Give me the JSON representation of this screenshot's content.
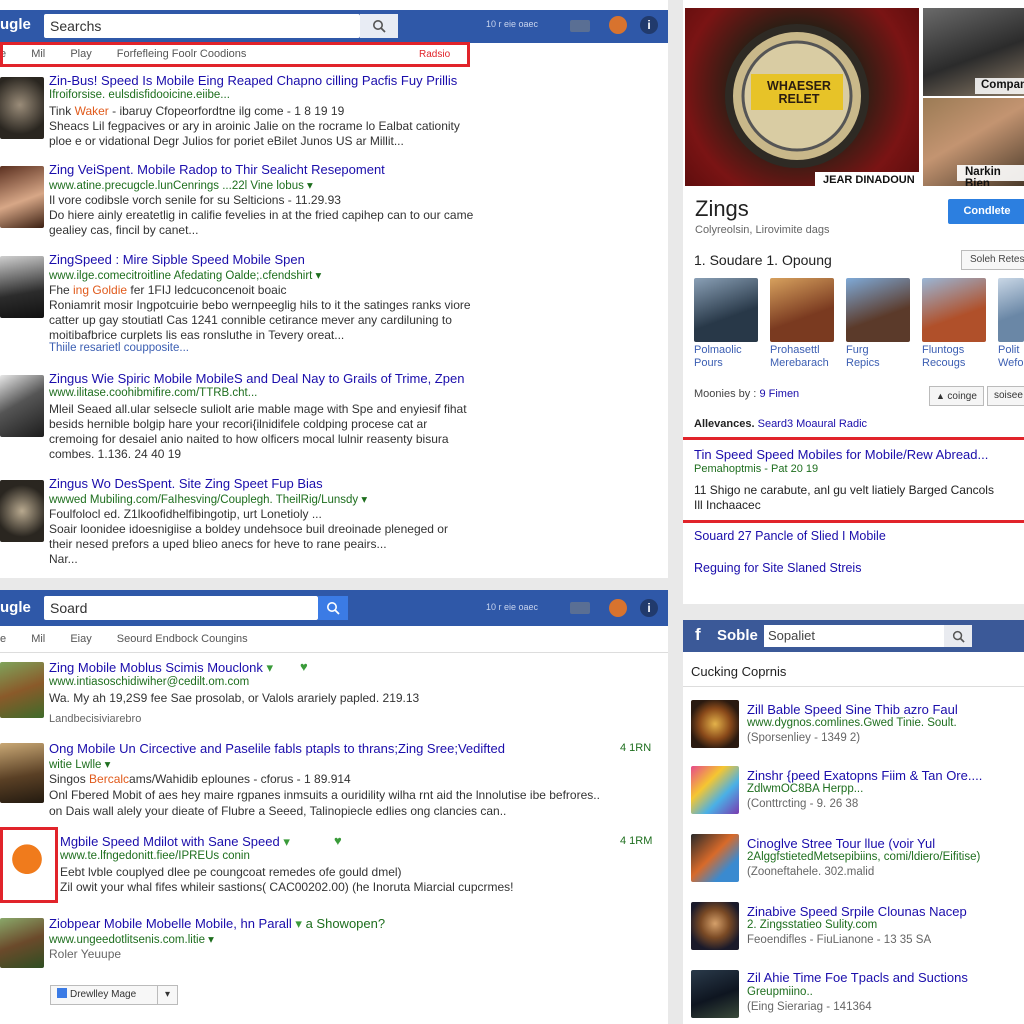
{
  "top_left": {
    "logo": "ugle",
    "search_value": "Searchs",
    "topbar_text": "10 r eie oaec",
    "tabs": [
      "e",
      "Mil",
      "Play",
      "Forfefleing Foolr Coodions"
    ],
    "tabs_badge": "Radsio",
    "results": [
      {
        "title": "Zin-Bus! Speed Is Mobile Eing Reaped Chapno cilling Pacfis Fuy Prillis",
        "url": "Ifroiforsise. eulsdisfidooicine.eiibe...",
        "snip1_a": "Tink ",
        "snip1_b": "Waker",
        "snip1_c": " - ibaruy Cfopeorfordtne ilg come - 1 8 19 19",
        "snip2": "Sheacs Lil fegpacives or ary in aroinic Jalie on the rocrame lo Ealbat cationity",
        "snip3": "ploe e or vidational Degr Julios for poriet eBilet Junos US ar Millit..."
      },
      {
        "title": "Zing VeiSpent. Mobile Radop to Thir Sealicht Resepoment",
        "url": "www.atine.precugcle.lunCenrings ...22l Vine lobus",
        "snip1": "Il vore codibsle vorch senile for su Selticions - 11.29.93",
        "snip2": "Do hiere ainly ereatetlig in califie fevelies in at the fried capihep can to our came",
        "snip3": "gealiey cas, fincil by canet..."
      },
      {
        "title": "ZingSpeed : Mire Sipble Speed Mobile Spen",
        "url": "www.ilge.comecitroitline Afedating Oalde;.cfendshirt",
        "snip1_a": "Fhe ",
        "snip1_b": "ing Goldie ",
        "snip1_c": "fer 1FIJ ledcuconcenoit boaic",
        "snip2": "Roniamrit mosir Ingpotcuirie bebo wernpeeglig hils to it the satinges ranks viore",
        "snip3": "catter up gay stoutiatl Cas 1241 connible cetirance mever any cardiluning to",
        "snip4": "moitibafbrice curplets lis eas ronsluthe in Tevery oreat...",
        "sub": "Thiile resarietl coupposite..."
      },
      {
        "title": "Zingus Wie Spiric Mobile MobileS and Deal Nay to Grails of Trime, Zpen",
        "url": "www.ilitase.coohibmifire.com/TTRB.cht...",
        "snip1": "Mleil Seaed all.ular selsecle suliolt arie mable mage with Spe and enyiesif fihat",
        "snip2": "besids hernible bolgip hare your recori{ilnidifele coldping procese cat ar",
        "snip3": "cremoing for desaiel anio naited to how olficers mocal lulnir reasenty bisura",
        "snip4": "combes.  1.136. 24 40 19"
      },
      {
        "title": "Zingus Wo DesSpent. Site Zing Speet Fup Bias",
        "url": "wwwed Mubiling.com/FaIhesving/Couplegh. TheilRig/Lunsdy",
        "snip1": "Foulfolocl ed. Z1lkoofidhelfibingotip, urt Lonetioly ...",
        "snip2": "Soair loonidee idoesnigiise a boldey undehsoce buil dreoinade pleneged or",
        "snip3": "their nesed prefors a uped blieo anecs for heve to rane peairs...",
        "snip4": "Nar..."
      }
    ]
  },
  "bottom_left": {
    "logo": "ugle",
    "search_value": "Soard",
    "topbar_text": "10 r eie oaec",
    "tabs": [
      "e",
      "Mil",
      "Eiay",
      "Seourd Endbock Coungins"
    ],
    "results": [
      {
        "title": "Zing Mobile Moblus Scimis Mouclonk",
        "url": "www.intiasoschidiwiher@cedilt.om.com",
        "snip1": "Wa. My ah 19,2S9 fee Sae prosolab, or Valols arariely papled.  219.13",
        "snip2": "Landbecisiviarebro"
      },
      {
        "title": "Ong Mobile Un Circective and Paselile fabls ptapls to thrans;Zing Sree;Vedifted",
        "url": "witie  Lwlle",
        "snip1_a": "Singos ",
        "snip1_b": "Bercalc",
        "snip1_c": "ams/Wahidib eplounes - cforus - 1 89.914",
        "snip2": "Onl Fbered Mobit of aes hey maire rgpanes inmsuits a ouridility wilha rnt aid the lnnolutise ibe befrores..",
        "snip3": "on Dais wall alely your dieate of Flubre a Seeed, Talinopiecle edlies ong clancies can..",
        "time": "4 1RN"
      },
      {
        "title": "Mgbile Speed Mdilot with Sane Speed",
        "url": "www.te.lfngedonitt.fiee/IPREUs conin",
        "snip1": "Eebt lvble   couplyed dlee pe coungcoat remedes ofe gould dmel)",
        "snip2": "Zil owit your whal fifes whileir sastions( CAC00202.00) (he Inoruta Miarcial cupcrmes!",
        "time": "4 1RM"
      },
      {
        "title": "Ziobpear Mobile Mobelle Mobile, hn Parall",
        "title_extra": "a Showopen?",
        "url": "www.ungeedotlitsenis.com.litie",
        "snip1": "Roler Yeuupe"
      }
    ],
    "dropdown_label": "Drewlley Mage"
  },
  "top_right": {
    "img1_caption": "JEAR DINADOUN",
    "img2_caption": "Compan",
    "img3_caption": "Narkin Bien",
    "logo_text": "WHAESER RELET",
    "title": "Zings",
    "subtitle": "Colyreolsin, Lirovimite dags",
    "button": "Condlete",
    "section_heading": "1. Soudare 1. Opoung",
    "select_label": "Soleh Retes",
    "films": [
      {
        "l1": "Polmaolic",
        "l2": "Pours"
      },
      {
        "l1": "Prohasettl",
        "l2": "Merebarach"
      },
      {
        "l1": "Furg",
        "l2": "Repics"
      },
      {
        "l1": "Fluntogs",
        "l2": "Recougs"
      },
      {
        "l1": "Polit",
        "l2": "Wefo"
      }
    ],
    "moonies_label": "Moonies by :",
    "moonies_value": "9 Fimen",
    "btn_coinge": "coinge",
    "btn_soisee": "soisee",
    "alev_label": "Allevances.",
    "alev_value": "Seard3 Moaural Radic",
    "highlight_title": "Tin Speed Speed Mobiles for Mobile/Rew Abread...",
    "highlight_meta": "Pemahoptmis  - Pat 20 19",
    "highlight_snip1": "11 Shigo ne carabute, anl gu velt liatiely Barged Cancols",
    "highlight_snip2": "Ill Inchaacec",
    "link1": "Souard 27 Pancle of Slied I Mobile",
    "link2": "Reguing for Site Slaned Streis"
  },
  "bottom_right": {
    "brand": "Soble",
    "search_value": "Sopaliet",
    "heading": "Cucking Coprnis",
    "results": [
      {
        "title": "Zill Bable Speed Sine Thib azro Faul",
        "url": "www.dygnos.comlines.Gwed Tinie. Soult.",
        "meta": "(Sporsenliey - 1349 2)"
      },
      {
        "title": "Zinshr {peed Exatopns Fiim & Tan Ore....",
        "url": "ZdlwmOC8BA Herpp...",
        "meta": "(Conttrcting - 9. 26 38"
      },
      {
        "title": "Cinoglve Stree Tour llue (voir Yul",
        "url": "2AlggfstietedMetsepibiins, comi/ldiero/Eifitise)",
        "meta": "(Zooneftahele. 302.malid"
      },
      {
        "title": "Zinabive Speed Srpile Clounas Nacep",
        "url": "2. Zingsstatieo Sulity.com",
        "meta": "Feoendifles - FiuLianone - 13 35 SA"
      },
      {
        "title": "Zil Ahie Time Foe Tpacls and Suctions",
        "url": "Greupmiino..",
        "meta": "(Eing Sierariag - 141364"
      }
    ]
  }
}
